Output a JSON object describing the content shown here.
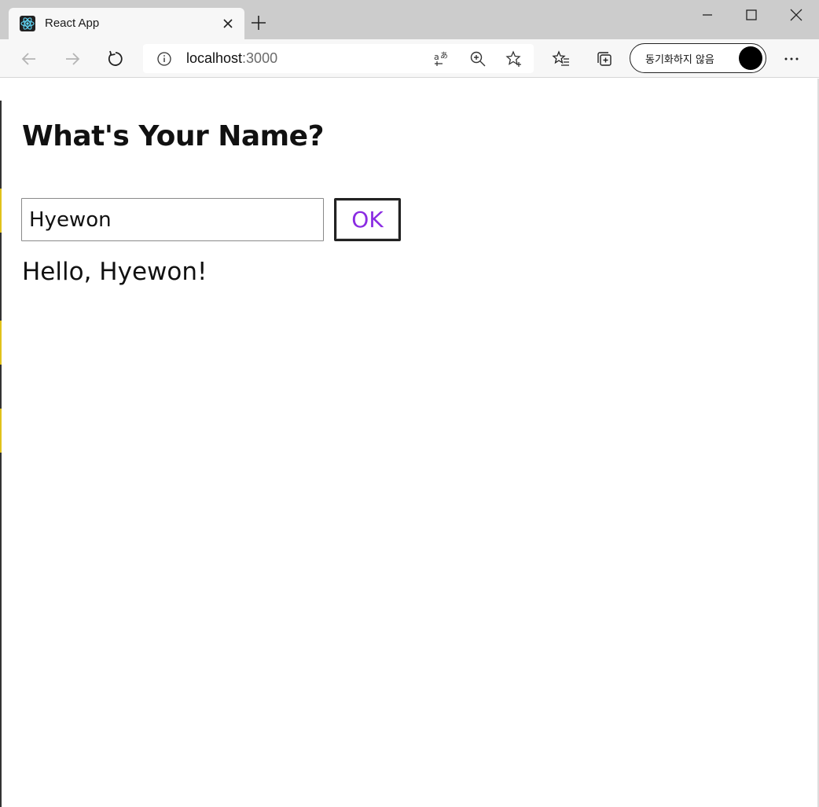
{
  "browser": {
    "tab": {
      "title": "React App"
    },
    "address_bar": {
      "host": "localhost",
      "port": ":3000"
    },
    "profile": {
      "sync_label": "동기화하지 않음"
    },
    "icons": {
      "favicon": "react-logo-icon",
      "tab_close": "close-icon",
      "new_tab": "plus-icon",
      "minimize": "minimize-icon",
      "maximize": "maximize-icon",
      "close_window": "close-icon",
      "back": "arrow-left-icon",
      "forward": "arrow-right-icon",
      "refresh": "refresh-icon",
      "site_info": "info-icon",
      "translate": "translate-icon",
      "zoom": "zoom-in-icon",
      "favorite": "star-icon",
      "favorites_list": "favorites-icon",
      "collections": "collections-icon",
      "more": "more-icon"
    }
  },
  "page": {
    "title": "What's Your Name?",
    "name_input": {
      "value": "Hyewon"
    },
    "ok_button": {
      "label": "OK"
    },
    "greeting": "Hello, Hyewon!"
  },
  "colors": {
    "accent_button_text": "#8a2be2",
    "react_logo": "#61dafb"
  }
}
